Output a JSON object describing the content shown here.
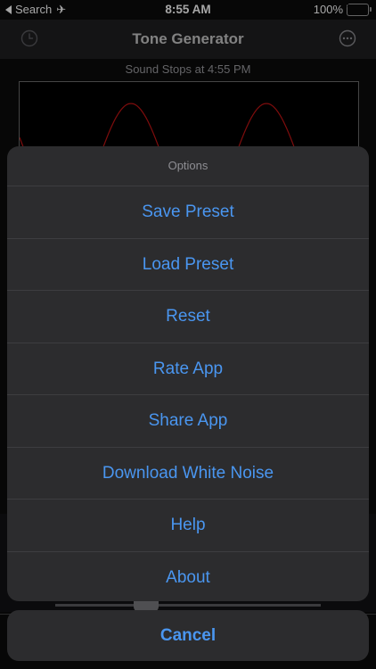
{
  "status_bar": {
    "back_label": "Search",
    "time": "8:55 AM",
    "battery_percent": "100%",
    "battery_level": 1.0,
    "battery_color": "#2fd158"
  },
  "nav": {
    "title": "Tone Generator",
    "left_icon": "history-clock-icon",
    "right_icon": "more-ellipsis-icon"
  },
  "sound_stops": "Sound Stops at 4:55 PM",
  "waveform": {
    "color": "#c41414",
    "shape": "sine"
  },
  "action_sheet": {
    "title": "Options",
    "items": [
      {
        "label": "Save Preset"
      },
      {
        "label": "Load Preset"
      },
      {
        "label": "Reset"
      },
      {
        "label": "Rate App"
      },
      {
        "label": "Share App"
      },
      {
        "label": "Download White Noise"
      },
      {
        "label": "Help"
      },
      {
        "label": "About"
      }
    ],
    "cancel_label": "Cancel",
    "accent_color": "#4a96f0"
  }
}
